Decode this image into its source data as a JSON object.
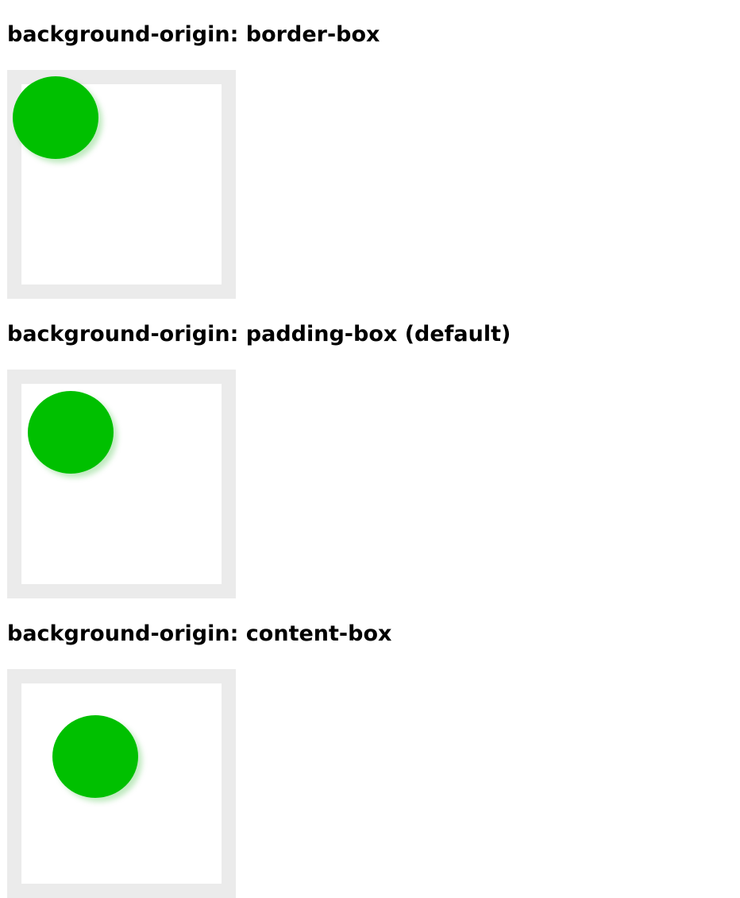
{
  "sections": [
    {
      "heading": "background-origin: border-box",
      "colors": {
        "border": "#ebebeb",
        "background": "#ffffff",
        "circle": "#00c000"
      }
    },
    {
      "heading": "background-origin: padding-box (default)",
      "colors": {
        "border": "#ebebeb",
        "background": "#ffffff",
        "circle": "#00c000"
      }
    },
    {
      "heading": "background-origin: content-box",
      "colors": {
        "border": "#ebebeb",
        "background": "#ffffff",
        "circle": "#00c000"
      }
    }
  ]
}
